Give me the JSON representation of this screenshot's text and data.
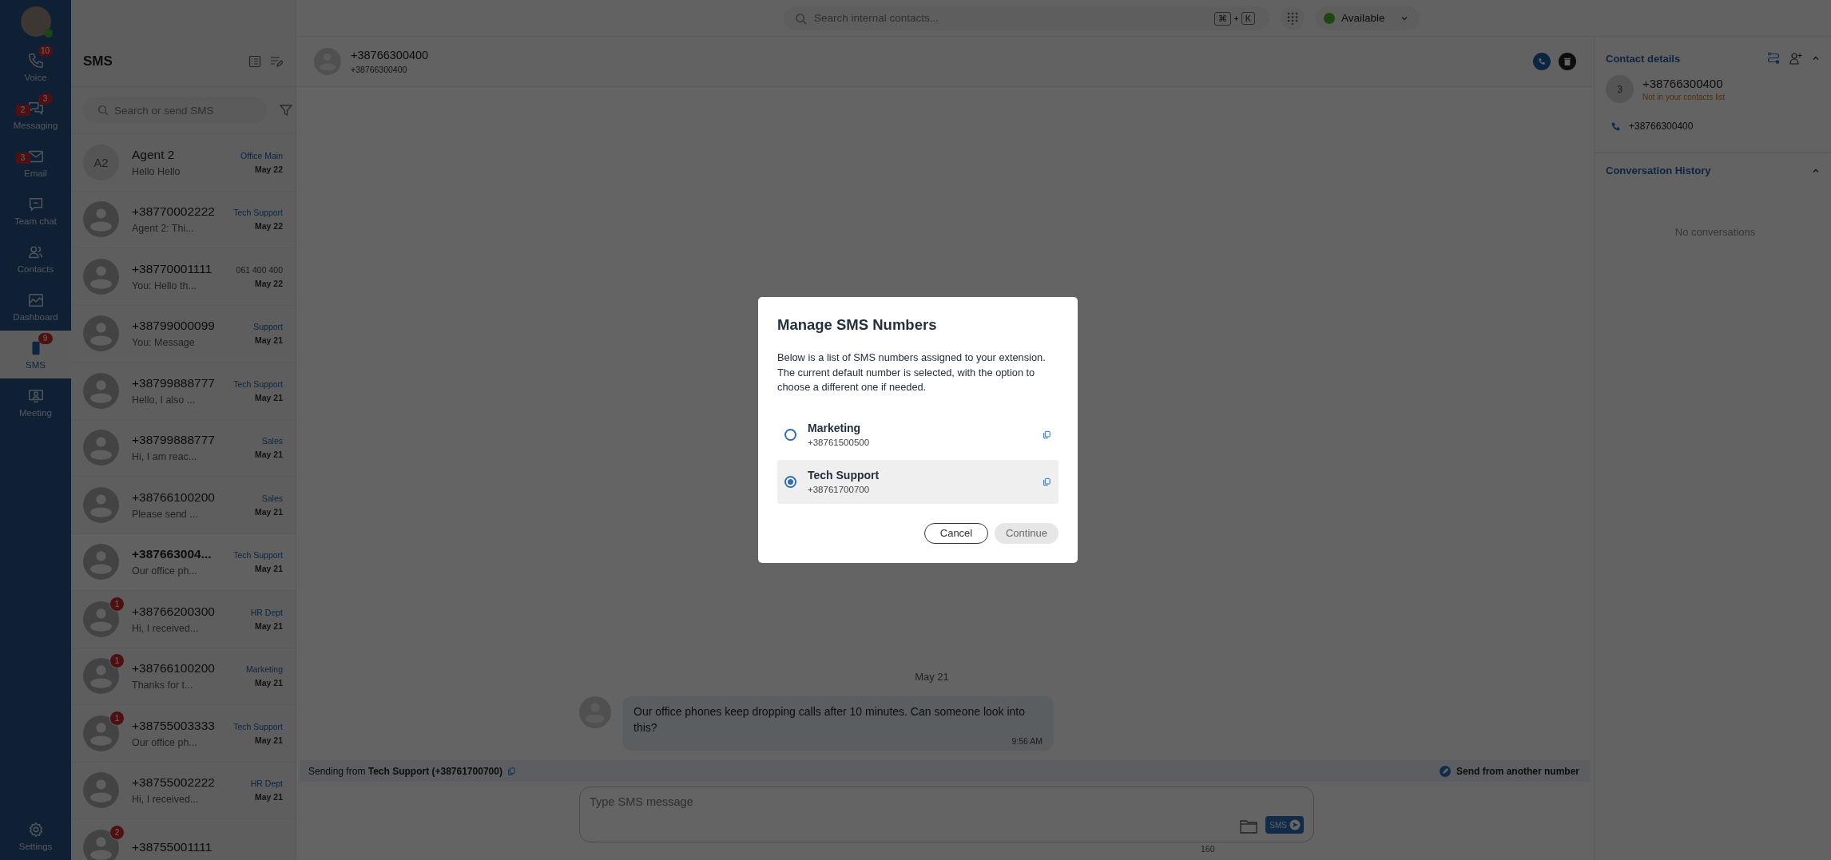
{
  "nav": {
    "items": [
      {
        "label": "Voice",
        "selected": false,
        "badges": [
          {
            "text": "10",
            "kind": "corner"
          }
        ]
      },
      {
        "label": "Messaging",
        "selected": false,
        "badges": [
          {
            "text": "3",
            "kind": "corner"
          },
          {
            "text": "2",
            "kind": "tag"
          }
        ]
      },
      {
        "label": "Email",
        "selected": false,
        "badges": [
          {
            "text": "3",
            "kind": "tag"
          }
        ]
      },
      {
        "label": "Team chat",
        "selected": false
      },
      {
        "label": "Contacts",
        "selected": false
      },
      {
        "label": "Dashboard",
        "selected": false
      },
      {
        "label": "SMS",
        "selected": true,
        "badges": [
          {
            "text": "9",
            "kind": "corner"
          }
        ]
      },
      {
        "label": "Meeting",
        "selected": false
      }
    ],
    "settings": {
      "label": "Settings"
    }
  },
  "sms_list": {
    "title": "SMS",
    "search": {
      "placeholder": "Search or send SMS"
    },
    "conversations": [
      {
        "initials": "A2",
        "name": "Agent 2",
        "preview": "Hello Hello",
        "line": {
          "text": "Office Main",
          "kind": "group"
        },
        "date": "May 22",
        "selected": false
      },
      {
        "name": "+38770002222",
        "preview": "Agent 2: Thi...",
        "line": {
          "text": "Tech Support",
          "kind": "group"
        },
        "date": "May 22",
        "selected": false
      },
      {
        "name": "+38770001111",
        "preview": "You: Hello th...",
        "line": {
          "text": "061 400 400",
          "kind": "number"
        },
        "date": "May 22",
        "selected": false
      },
      {
        "name": "+38799000099",
        "preview": "You: Message",
        "line": {
          "text": "Support",
          "kind": "group"
        },
        "date": "May 21",
        "selected": false
      },
      {
        "name": "+38799888777",
        "preview": "Hello, I also ...",
        "line": {
          "text": "Tech Support",
          "kind": "group"
        },
        "date": "May 21",
        "selected": false
      },
      {
        "name": "+38799888777",
        "preview": "Hi, I am reac...",
        "line": {
          "text": "Sales",
          "kind": "group"
        },
        "date": "May 21",
        "selected": false
      },
      {
        "name": "+38766100200",
        "preview": "Please send ...",
        "line": {
          "text": "Sales",
          "kind": "group"
        },
        "date": "May 21",
        "selected": false
      },
      {
        "name": "+387663004...",
        "preview": "Our office ph...",
        "line": {
          "text": "Tech Support",
          "kind": "group"
        },
        "date": "May 21",
        "selected": true
      },
      {
        "name": "+38766200300",
        "preview": "Hi, I received...",
        "line": {
          "text": "HR Dept",
          "kind": "group"
        },
        "date": "May 21",
        "selected": false,
        "unread": "1"
      },
      {
        "name": "+38766100200",
        "preview": "Thanks for t...",
        "line": {
          "text": "Marketing",
          "kind": "group"
        },
        "date": "May 21",
        "selected": false,
        "unread": "1"
      },
      {
        "name": "+38755003333",
        "preview": "Our office ph...",
        "line": {
          "text": "Tech Support",
          "kind": "group"
        },
        "date": "May 21",
        "selected": false,
        "unread": "1"
      },
      {
        "name": "+38755002222",
        "preview": "Hi, I received...",
        "line": {
          "text": "HR Dept",
          "kind": "group"
        },
        "date": "May 21",
        "selected": false
      },
      {
        "name": "+38755001111",
        "selected": false,
        "unread": "2"
      }
    ]
  },
  "top_bar": {
    "search": {
      "placeholder": "Search internal contacts..."
    },
    "shortcut": [
      "⌘",
      "+",
      "K"
    ],
    "status": {
      "label": "Available"
    }
  },
  "chat": {
    "header": {
      "title": "+38766300400",
      "subtitle": "+38766300400"
    },
    "date": "May 21",
    "messages": [
      {
        "text": "Our office phones keep dropping calls after 10 minutes. Can someone look into this?",
        "time": "9:56 AM"
      }
    ],
    "sending_bar": {
      "text": "Sending from **Tech Support (+38761700700)**",
      "action": "Send from another number"
    },
    "composer": {
      "placeholder": "Type SMS message",
      "send": "SMS",
      "counter": "160"
    }
  },
  "contact_panel": {
    "title": "Contact details",
    "avatar": "3",
    "name": "+38766300400",
    "note": "Not in your contacts list",
    "phone": "+38766300400",
    "history": {
      "title": "Conversation History",
      "empty": "No conversations"
    }
  },
  "dialog": {
    "title": "Manage SMS Numbers",
    "description": "Below is a list of SMS numbers assigned to your extension. The current default number is selected, with the option to choose a different one if needed.",
    "options": [
      {
        "name": "Marketing",
        "number": "+38761500500",
        "selected": false
      },
      {
        "name": "Tech Support",
        "number": "+38761700700",
        "selected": true
      }
    ],
    "buttons": [
      {
        "label": "Cancel",
        "disabled": false
      },
      {
        "label": "Continue",
        "disabled": true
      }
    ]
  }
}
